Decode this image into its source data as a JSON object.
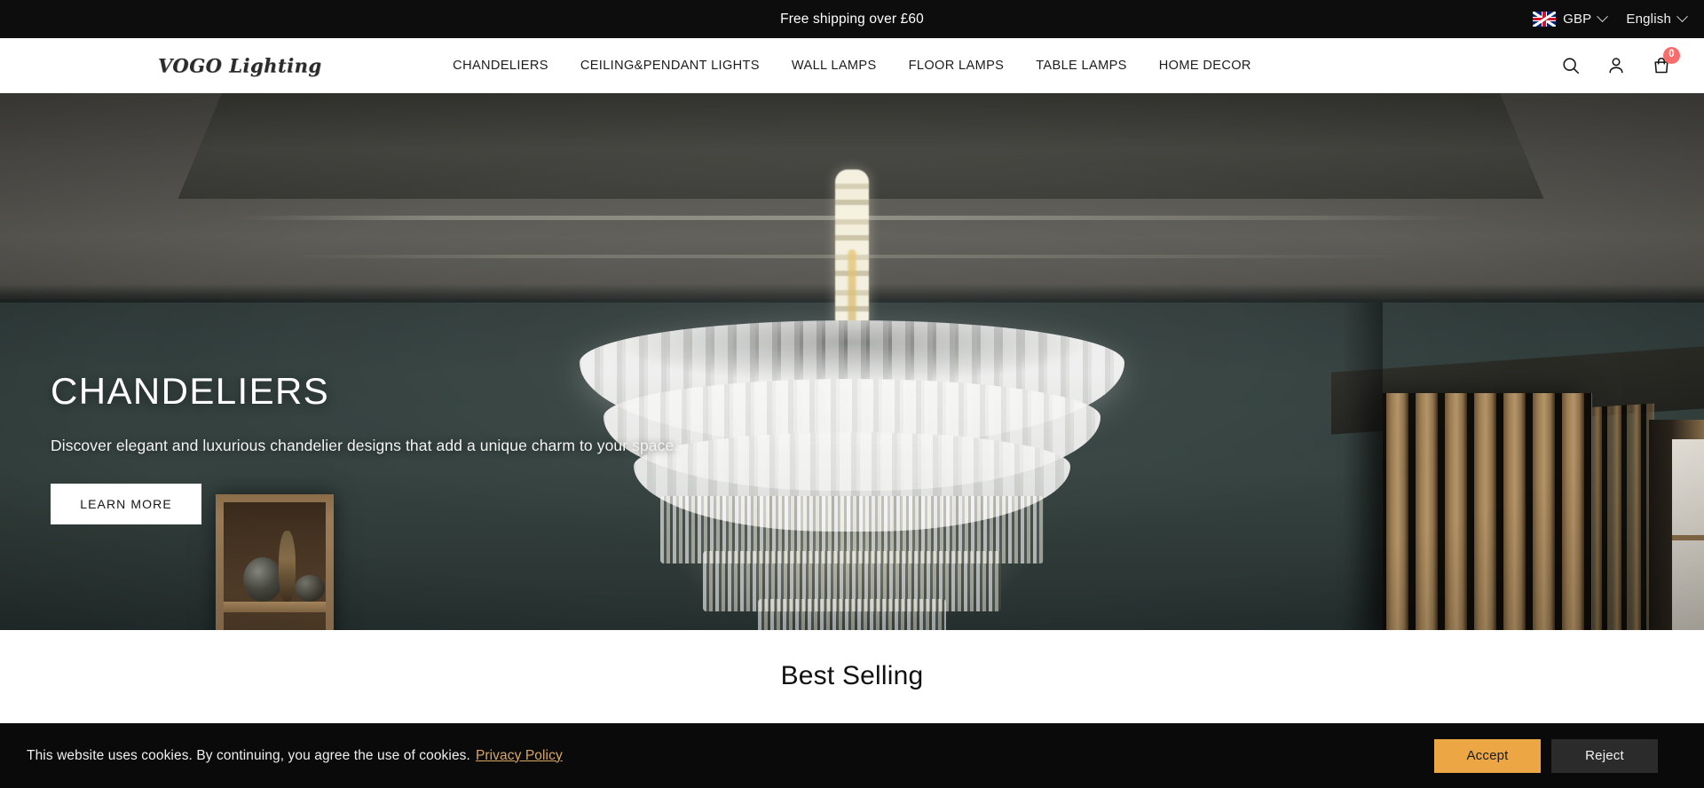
{
  "announcement": {
    "message": "Free shipping over £60",
    "currency": {
      "flag_icon": "uk-flag-icon",
      "label": "GBP",
      "caret_icon": "chevron-down-icon"
    },
    "language": {
      "label": "English",
      "caret_icon": "chevron-down-icon"
    }
  },
  "header": {
    "logo": "VOGO Lighting",
    "nav": [
      {
        "label": "CHANDELIERS"
      },
      {
        "label": "CEILING&PENDANT LIGHTS"
      },
      {
        "label": "WALL LAMPS"
      },
      {
        "label": "FLOOR LAMPS"
      },
      {
        "label": "TABLE LAMPS"
      },
      {
        "label": "HOME DECOR"
      }
    ],
    "actions": {
      "search_icon": "search-icon",
      "account_icon": "user-account-icon",
      "cart_icon": "shopping-bag-icon",
      "cart_count": "0"
    }
  },
  "hero": {
    "title": "CHANDELIERS",
    "subtitle": "Discover elegant and luxurious chandelier designs that add a unique charm to your space.",
    "cta_label": "LEARN MORE",
    "image_alt": "Large tiered frosted glass and crystal chandelier hanging in a dark teal room with wooden slat wall and niche shelving"
  },
  "best_selling": {
    "title": "Best Selling"
  },
  "cookie_banner": {
    "text": "This website uses cookies. By continuing, you agree the use of cookies.",
    "link_label": "Privacy Policy",
    "accept_label": "Accept",
    "reject_label": "Reject"
  },
  "colors": {
    "announcement_bg": "#0d0d0d",
    "accent_orange": "#eca744",
    "cart_badge": "#f96c6c",
    "cookie_link": "#d9a863",
    "hero_wall": "#35423f"
  }
}
